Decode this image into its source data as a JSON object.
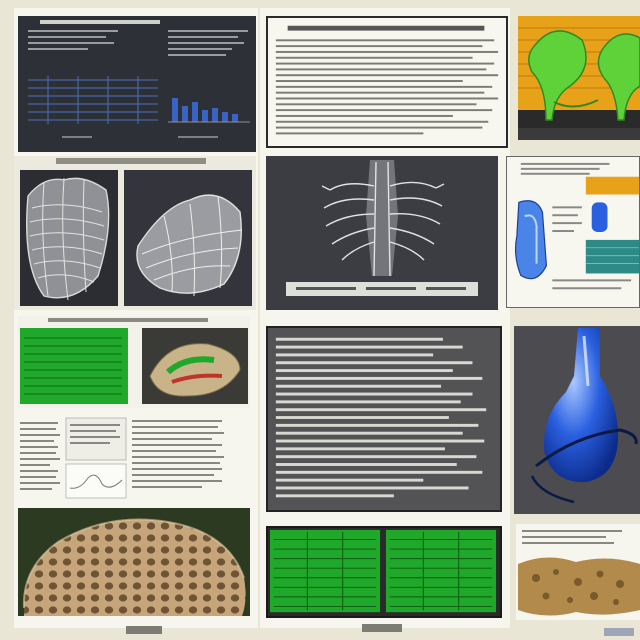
{
  "colors": {
    "page": "#e9e6d6",
    "dark_panel": "#2e3038",
    "paper": "#f7f6ef",
    "green": "#1fa82a",
    "leaf_green": "#5fd23a",
    "amber": "#e8a21a",
    "blue": "#2a5fe0",
    "sponge": "#b28a4c"
  },
  "panels": [
    {
      "id": "p1",
      "kind": "chart-printout"
    },
    {
      "id": "p2",
      "kind": "text-document"
    },
    {
      "id": "p3",
      "kind": "leaf-illustration"
    },
    {
      "id": "p4",
      "kind": "mesh-render"
    },
    {
      "id": "p5",
      "kind": "skeleton-xray"
    },
    {
      "id": "p6",
      "kind": "blue-vessel-diagram"
    },
    {
      "id": "p7",
      "kind": "green-report"
    },
    {
      "id": "p8",
      "kind": "dense-text-document"
    },
    {
      "id": "p9",
      "kind": "blue-glass-render"
    },
    {
      "id": "p10",
      "kind": "mixed-printout"
    },
    {
      "id": "p11",
      "kind": "green-table"
    },
    {
      "id": "p12",
      "kind": "sponge-photo"
    },
    {
      "id": "p13",
      "kind": "cell-texture-photo"
    }
  ]
}
